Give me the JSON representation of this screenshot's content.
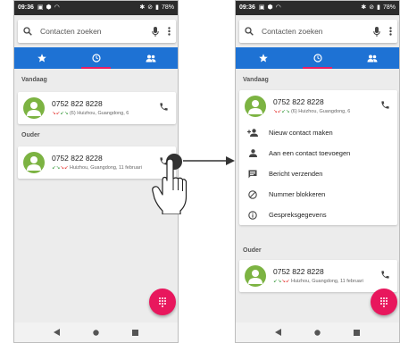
{
  "status": {
    "time": "09:36",
    "battery": "78%"
  },
  "search": {
    "placeholder": "Contacten zoeken"
  },
  "tabs": [
    {
      "icon": "star-icon",
      "active": false
    },
    {
      "icon": "clock-icon",
      "active": true
    },
    {
      "icon": "contacts-icon",
      "active": false
    }
  ],
  "sections": {
    "today": "Vandaag",
    "older": "Ouder"
  },
  "calls": {
    "today": {
      "number": "0752 822 8228",
      "detail": "(6) Huizhou, Guangdong, 6"
    },
    "older": {
      "number": "0752 822 8228",
      "detail": "Huizhou, Guangdong, 11 februari"
    }
  },
  "menu": [
    {
      "icon": "add-contact-icon",
      "label": "Nieuw contact maken"
    },
    {
      "icon": "person-icon",
      "label": "Aan een contact toevoegen"
    },
    {
      "icon": "message-icon",
      "label": "Bericht verzenden"
    },
    {
      "icon": "block-icon",
      "label": "Nummer blokkeren"
    },
    {
      "icon": "info-icon",
      "label": "Gespreksgegevens"
    }
  ],
  "colors": {
    "tab_bar": "#1e72d4",
    "fab": "#e8175d",
    "avatar": "#7cb342",
    "tab_indicator": "#e91e63"
  }
}
